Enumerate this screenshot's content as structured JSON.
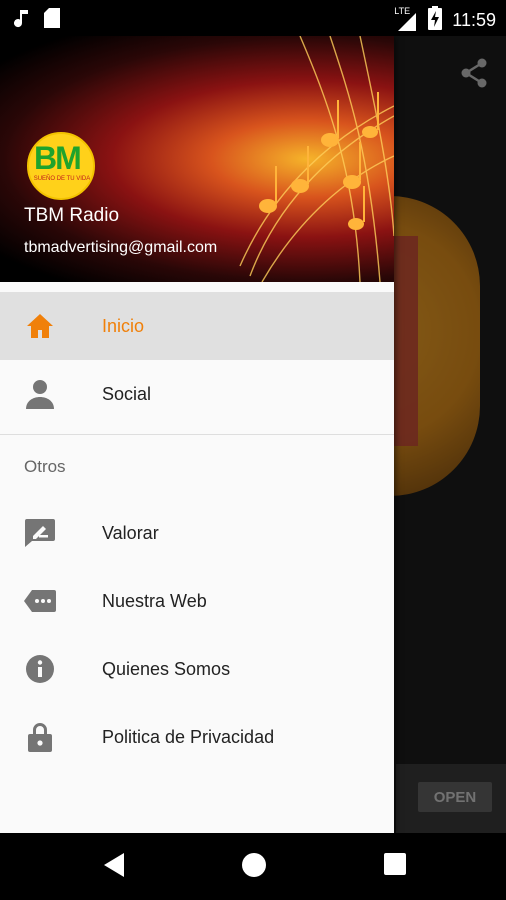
{
  "status_bar": {
    "time": "11:59",
    "network": "LTE",
    "icons": [
      "music-note-icon",
      "sd-card-icon",
      "signal-icon",
      "battery-charging-icon"
    ]
  },
  "app": {
    "action_icon": "share-icon",
    "ad_button_label": "OPEN"
  },
  "drawer": {
    "header": {
      "logo_text": "BM",
      "logo_subtext": "SUEÑO DE TU VIDA",
      "name": "TBM Radio",
      "email": "tbmadvertising@gmail.com"
    },
    "items": [
      {
        "label": "Inicio",
        "icon": "home-icon",
        "active": true
      },
      {
        "label": "Social",
        "icon": "person-icon",
        "active": false
      }
    ],
    "section_title": "Otros",
    "other_items": [
      {
        "label": "Valorar",
        "icon": "rate-review-icon"
      },
      {
        "label": "Nuestra Web",
        "icon": "web-tag-icon"
      },
      {
        "label": "Quienes Somos",
        "icon": "info-icon"
      },
      {
        "label": "Politica de Privacidad",
        "icon": "lock-icon"
      }
    ]
  },
  "nav_bar": {
    "buttons": [
      "back-icon",
      "home-circle-icon",
      "recents-icon"
    ]
  },
  "colors": {
    "accent": "#f0800a",
    "icon_gray": "#757575",
    "active_row": "#e0e0e0"
  }
}
